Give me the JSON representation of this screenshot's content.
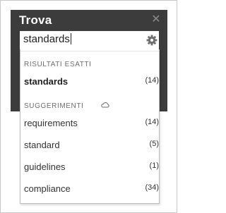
{
  "pane": {
    "title": "Trova",
    "close_glyph": "✕"
  },
  "search": {
    "value": "standards",
    "options_icon": "gear-icon"
  },
  "exact_results": {
    "header": "RISULTATI ESATTI",
    "items": [
      {
        "label": "standards",
        "count": "(14)"
      }
    ]
  },
  "suggestions": {
    "header": "SUGGERIMENTI",
    "header_icon": "cloud-icon",
    "items": [
      {
        "label": "requirements",
        "count": "(14)"
      },
      {
        "label": "standard",
        "count": "(5)"
      },
      {
        "label": "guidelines",
        "count": "(1)"
      },
      {
        "label": "compliance",
        "count": "(34)"
      }
    ]
  },
  "colors": {
    "pane_background": "#3c3c3c",
    "title_text": "#ffffff",
    "header_text": "#6e6e6e",
    "item_text": "#333333"
  }
}
